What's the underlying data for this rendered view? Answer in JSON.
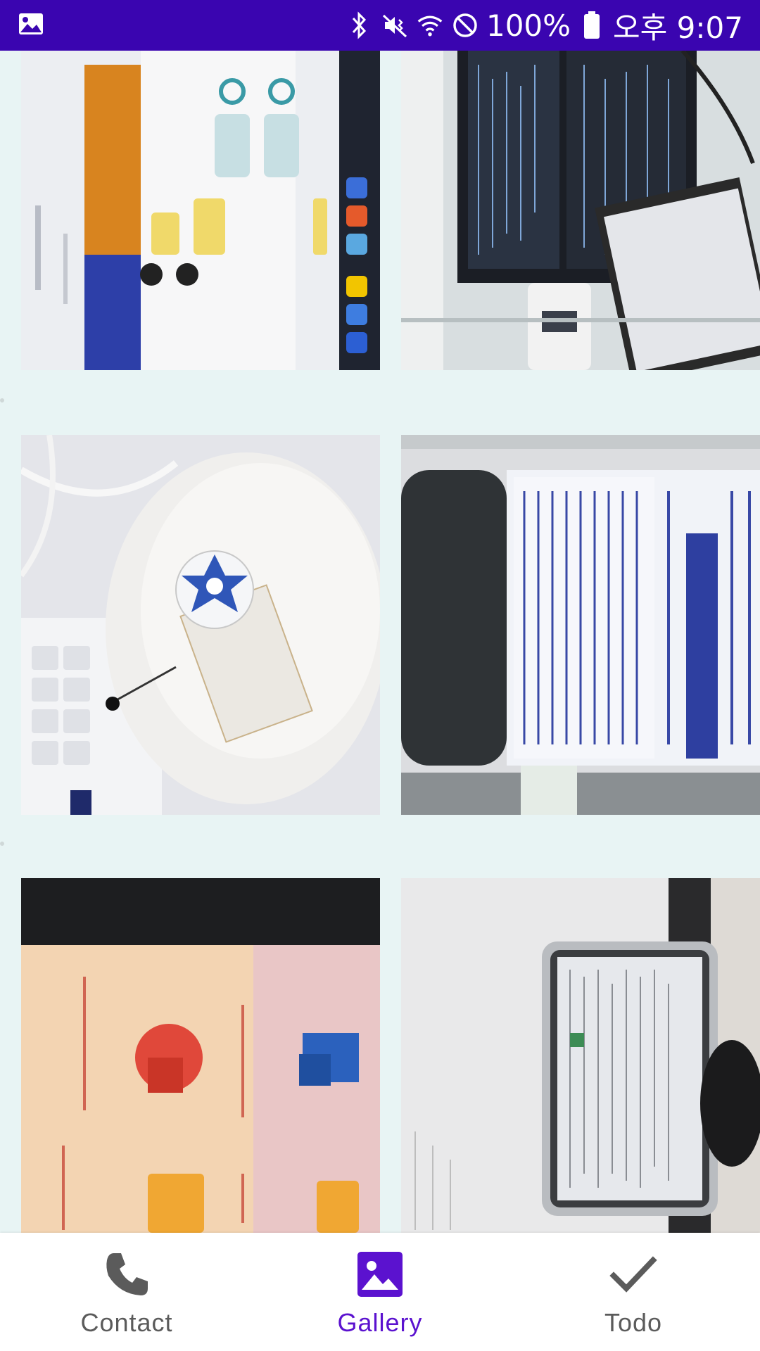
{
  "status_bar": {
    "battery": "100%",
    "time": "오후 9:07",
    "bg_color": "#3a05b0"
  },
  "gallery": {
    "photos": [
      {
        "description_icon": "chat-screenshot-photo"
      },
      {
        "description_icon": "monitor-code-photo"
      },
      {
        "description_icon": "mouse-sticker-photo"
      },
      {
        "description_icon": "bottle-label-photo"
      },
      {
        "description_icon": "desktop-icons-photo"
      },
      {
        "description_icon": "tablet-desk-photo"
      }
    ]
  },
  "bottom_nav": {
    "items": [
      {
        "label": "Contact",
        "icon": "phone-icon",
        "active": false
      },
      {
        "label": "Gallery",
        "icon": "image-icon",
        "active": true
      },
      {
        "label": "Todo",
        "icon": "check-icon",
        "active": false
      }
    ],
    "active_color": "#5b12cf",
    "inactive_color": "#5b5b5b"
  }
}
